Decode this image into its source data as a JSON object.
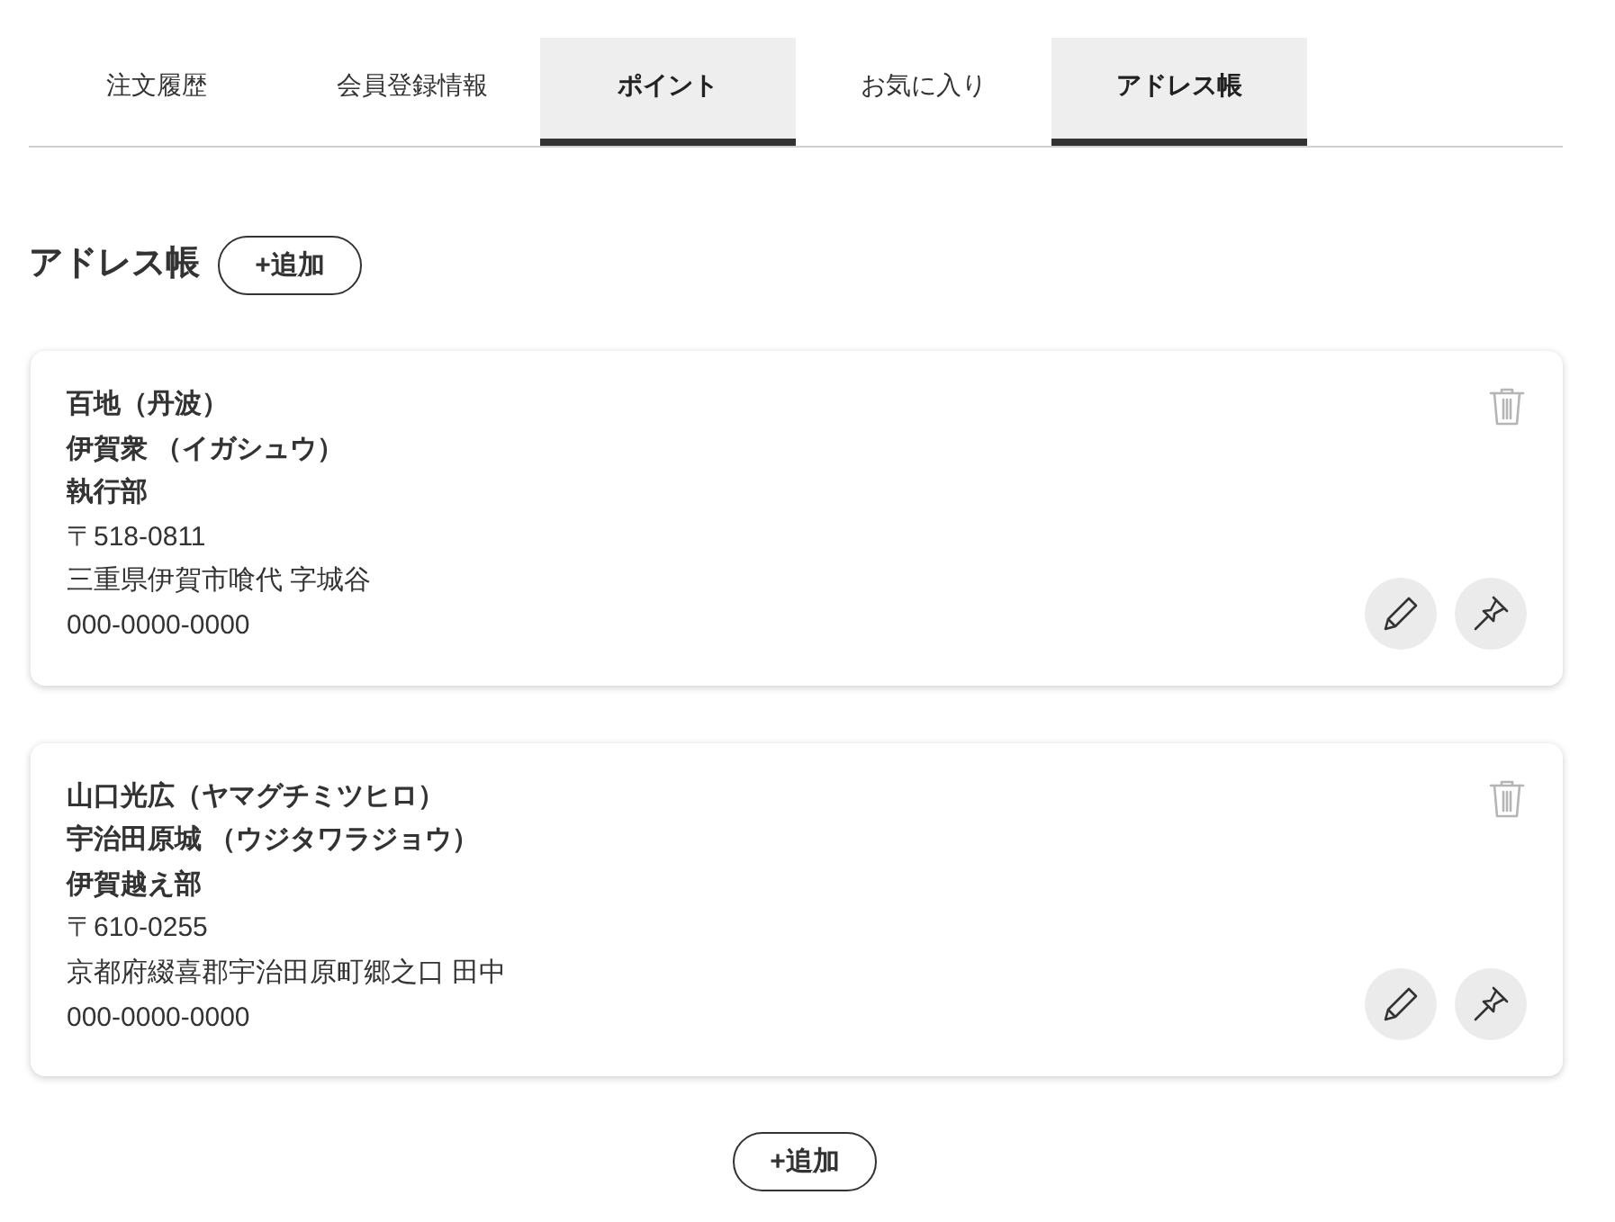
{
  "tabs": [
    {
      "label": "注文履歴",
      "selected": false
    },
    {
      "label": "会員登録情報",
      "selected": false
    },
    {
      "label": "ポイント",
      "selected": true
    },
    {
      "label": "お気に入り",
      "selected": false
    },
    {
      "label": "アドレス帳",
      "selected": true
    }
  ],
  "section": {
    "title": "アドレス帳",
    "add_button": "+追加"
  },
  "addresses": [
    {
      "name": "百地（丹波）",
      "company": "伊賀衆 （イガシュウ）",
      "department": "執行部",
      "postal_code": "〒518-0811",
      "address": "三重県伊賀市喰代 字城谷",
      "phone": "000-0000-0000"
    },
    {
      "name": "山口光広（ヤマグチミツヒロ）",
      "company": "宇治田原城 （ウジタワラジョウ）",
      "department": "伊賀越え部",
      "postal_code": "〒610-0255",
      "address": "京都府綴喜郡宇治田原町郷之口 田中",
      "phone": "000-0000-0000"
    }
  ],
  "footer_add_button": "+追加"
}
